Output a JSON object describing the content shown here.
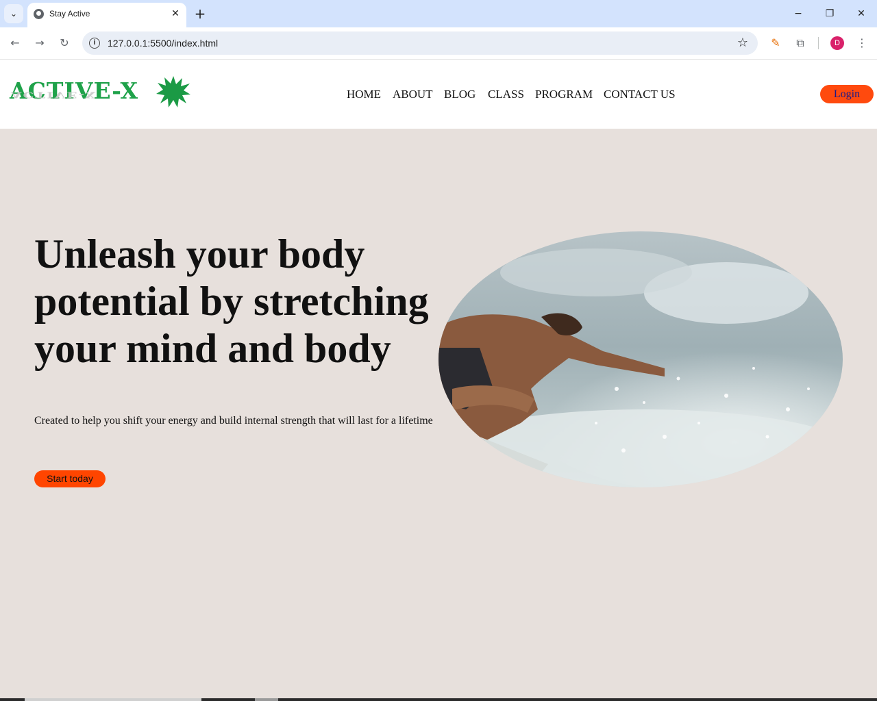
{
  "browser": {
    "tab_title": "Stay Active",
    "url": "127.0.0.1:5500/index.html",
    "profile_initial": "D",
    "icons": [
      "tab-search-icon",
      "globe-icon",
      "close-icon",
      "plus-icon",
      "minimize-icon",
      "restore-icon",
      "back-icon",
      "forward-icon",
      "reload-icon",
      "info-icon",
      "star-icon",
      "extension-icon",
      "puzzle-icon",
      "menu-icon"
    ]
  },
  "site": {
    "logo_text": "ACTIVE-X",
    "nav": [
      "HOME",
      "ABOUT",
      "BLOG",
      "CLASS",
      "PROGRAM",
      "CONTACT US"
    ],
    "login_label": "Login",
    "accent_color": "#ff4500",
    "logo_color": "#1fa24a"
  },
  "hero": {
    "title": "Unleash your body potential by stretching your mind and body",
    "subtitle": "Created to help you shift your energy and build internal strength that will last for a lifetime",
    "cta_label": "Start today",
    "image_alt": "surfer-photo"
  }
}
